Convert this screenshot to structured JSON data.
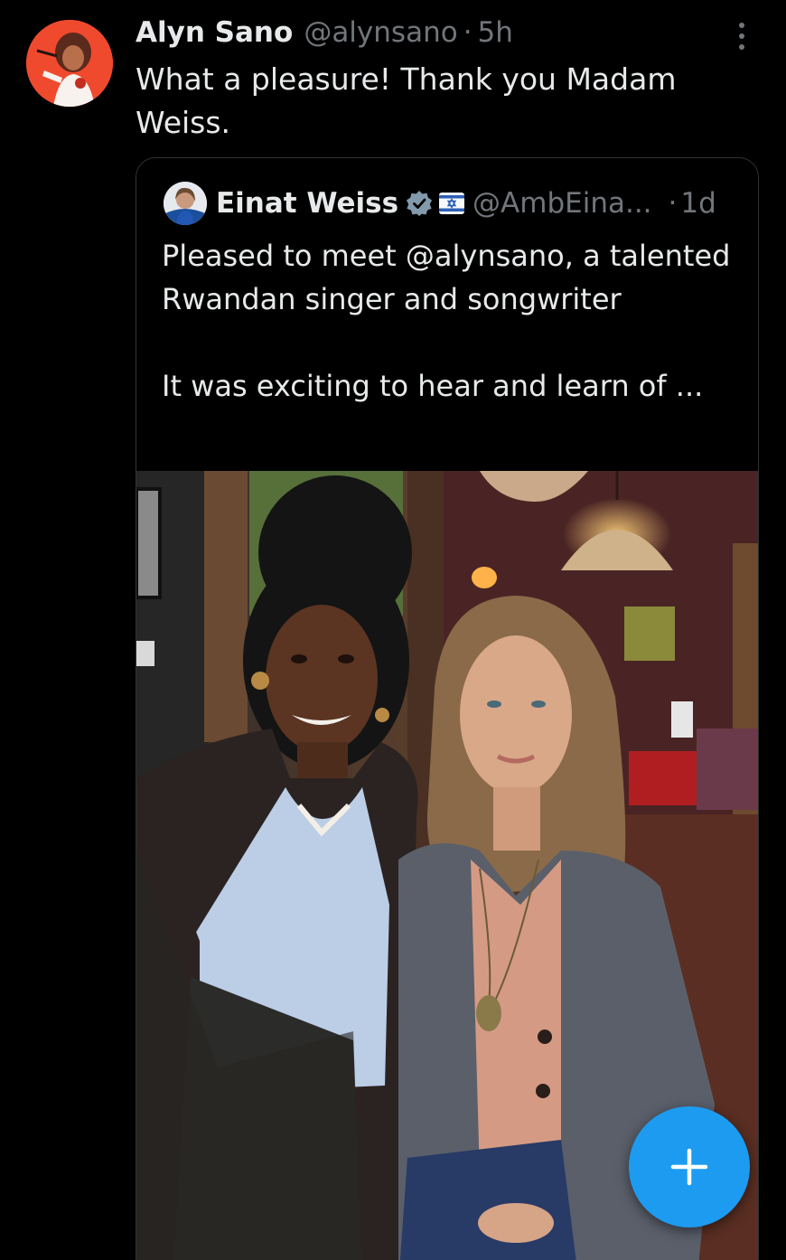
{
  "tweet": {
    "author_name": "Alyn Sano",
    "author_handle": "@alynsano",
    "separator": "·",
    "time": "5h",
    "text": "What a pleasure! Thank you Madam Weiss."
  },
  "quoted_tweet": {
    "author_name": "Einat Weiss",
    "author_handle": "@AmbEina...",
    "separator": "·",
    "time": "1d",
    "text": "Pleased to meet @alynsano, a talented   Rwandan singer and songwriter\n\nIt was exciting to hear and learn of ..."
  },
  "icons": {
    "more": "more-vertical-icon",
    "verified": "verified-badge-icon",
    "flag": "flag-emoji-icon",
    "compose": "plus-icon"
  },
  "colors": {
    "background": "#000000",
    "text": "#e7e9ea",
    "muted": "#71767b",
    "accent": "#1d9bf0",
    "border": "#2f3336"
  }
}
